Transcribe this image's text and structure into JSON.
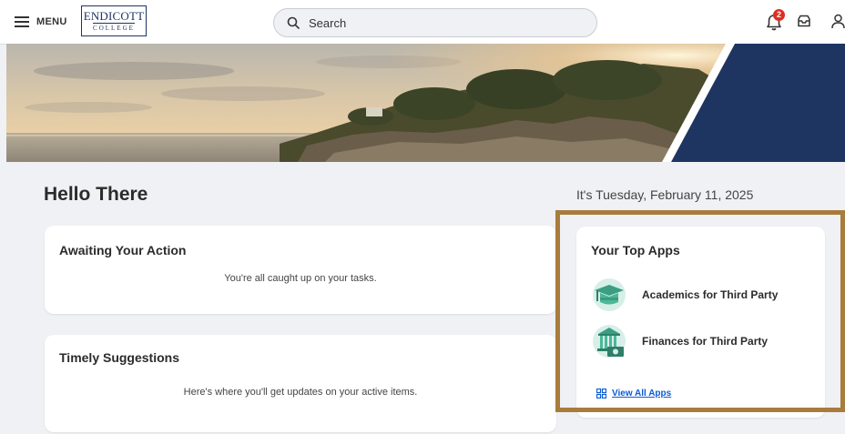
{
  "header": {
    "menu_label": "MENU",
    "logo": {
      "line1": "ENDICOTT",
      "line2": "COLLEGE"
    },
    "search": {
      "placeholder": "Search",
      "icon": "search-icon"
    },
    "notifications": {
      "icon": "bell-icon",
      "count": "2"
    },
    "inbox_icon": "inbox-icon",
    "profile_icon": "user-icon",
    "colors": {
      "brand": "#1d3561",
      "badge": "#de2e21"
    }
  },
  "banner": {
    "accent_color": "#1e3561"
  },
  "greeting": "Hello There",
  "date_text": "It's Tuesday, February 11, 2025",
  "awaiting": {
    "title": "Awaiting Your Action",
    "message": "You're all caught up on your tasks."
  },
  "suggestions": {
    "title": "Timely Suggestions",
    "message": "Here's where you'll get updates on your active items."
  },
  "top_apps": {
    "title": "Your Top Apps",
    "items": [
      {
        "label": "Academics for Third Party",
        "icon": "graduation-cap-icon"
      },
      {
        "label": "Finances for Third Party",
        "icon": "bank-money-icon"
      }
    ],
    "view_all_label": "View All Apps",
    "highlight_color": "#a87c3c",
    "link_color": "#0b5cd5"
  }
}
